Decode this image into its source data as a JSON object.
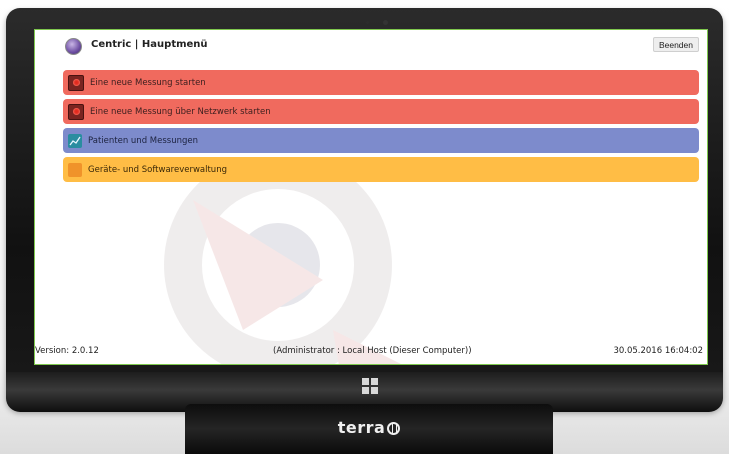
{
  "app": {
    "title": "Centric | Hauptmenü",
    "exit_label": "Beenden"
  },
  "menu": {
    "items": [
      {
        "label": "Eine neue Messung starten",
        "icon": "record-icon",
        "color": "#f06a5e"
      },
      {
        "label": "Eine neue Messung über Netzwerk starten",
        "icon": "record-icon",
        "color": "#f06a5e"
      },
      {
        "label": "Patienten und Messungen",
        "icon": "chart-icon",
        "color": "#7d8bcc"
      },
      {
        "label": "Geräte- und Softwareverwaltung",
        "icon": "tools-icon",
        "color": "#ffbd45"
      }
    ]
  },
  "status": {
    "version": "Version: 2.0.12",
    "host": "(Administrator : Local Host (Dieser Computer))",
    "datetime": "30.05.2016 16:04:02"
  },
  "hardware": {
    "brand": "terra"
  },
  "colors": {
    "accent_border": "#7fc84e"
  }
}
